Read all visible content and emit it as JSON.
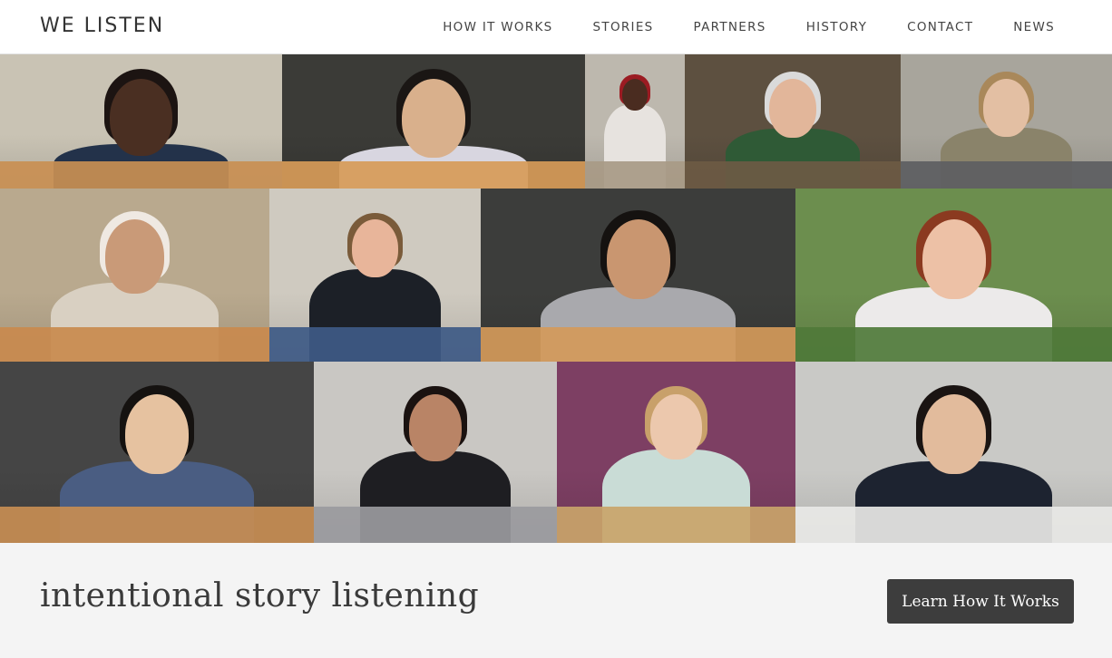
{
  "header": {
    "brand": "WE LISTEN",
    "nav": [
      {
        "label": "HOW IT WORKS"
      },
      {
        "label": "STORIES"
      },
      {
        "label": "PARTNERS"
      },
      {
        "label": "HISTORY"
      },
      {
        "label": "CONTACT"
      },
      {
        "label": "NEWS"
      }
    ]
  },
  "collage": {
    "tiles": [
      {
        "name": "storyteller-photo-1",
        "wall": "#c9c3b4",
        "shirt": "#23324a",
        "skin": "#4a2f22",
        "hair": "#1c1412",
        "desk": "#c98f52"
      },
      {
        "name": "storyteller-photo-2",
        "wall": "#3b3b37",
        "shirt": "#d8d6e0",
        "skin": "#d9b08c",
        "hair": "#1a1614",
        "desk": "#d79b58"
      },
      {
        "name": "storyteller-photo-3",
        "wall": "#bdb8ae",
        "shirt": "#e7e3df",
        "skin": "#4a2c20",
        "hair": "#9b1b22",
        "desk": "#a89a86"
      },
      {
        "name": "storyteller-photo-4",
        "wall": "#5d5040",
        "shirt": "#2f5a36",
        "skin": "#e2b69a",
        "hair": "#dadada",
        "desk": "#6d5a44"
      },
      {
        "name": "storyteller-photo-5",
        "wall": "#a8a59c",
        "shirt": "#8a836a",
        "skin": "#e3bfa3",
        "hair": "#a9885a",
        "desk": "#5d5e62"
      },
      {
        "name": "storyteller-photo-6",
        "wall": "#b9a98e",
        "shirt": "#d9d0c2",
        "skin": "#c99a78",
        "hair": "#efe9e2",
        "desk": "#c98a4e"
      },
      {
        "name": "storyteller-photo-7",
        "wall": "#cfcac0",
        "shirt": "#1c2027",
        "skin": "#e8b59a",
        "hair": "#7a5b3a",
        "desk": "#3e5a86"
      },
      {
        "name": "storyteller-photo-8",
        "wall": "#3c3d3b",
        "shirt": "#a9a9ad",
        "skin": "#c99670",
        "hair": "#151210",
        "desk": "#d49a5a"
      },
      {
        "name": "storyteller-photo-9",
        "wall": "#6c8e4e",
        "shirt": "#eceaea",
        "skin": "#edc1a6",
        "hair": "#8b3a20",
        "desk": "#4f7a3a"
      },
      {
        "name": "storyteller-photo-10",
        "wall": "#454545",
        "shirt": "#4a5d82",
        "skin": "#e6c2a0",
        "hair": "#151210",
        "desk": "#c78d52"
      },
      {
        "name": "storyteller-photo-11",
        "wall": "#c9c7c3",
        "shirt": "#1e1e22",
        "skin": "#b98466",
        "hair": "#1a1210",
        "desk": "#9a9a9e"
      },
      {
        "name": "storyteller-photo-12",
        "wall": "#7d3f63",
        "shirt": "#c9dcd6",
        "skin": "#ecc8ad",
        "hair": "#c8a06a",
        "desk": "#c9a46a"
      },
      {
        "name": "storyteller-photo-13",
        "wall": "#c9c9c6",
        "shirt": "#1d2330",
        "skin": "#e2bb9c",
        "hair": "#1a1412",
        "desk": "#e8e8e6"
      }
    ]
  },
  "hero": {
    "tagline": "intentional story listening",
    "cta_label": "Learn How It Works"
  }
}
